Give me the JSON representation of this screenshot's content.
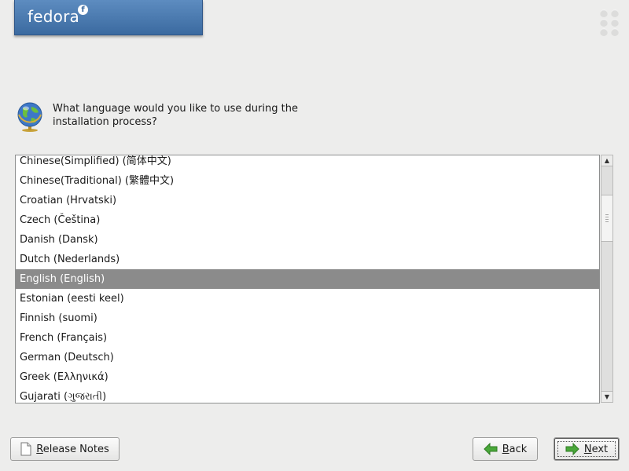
{
  "brand": {
    "name": "fedora",
    "mark": "f"
  },
  "prompt": {
    "icon": "globe-icon",
    "text": "What language would you like to use during the installation process?"
  },
  "language_list": {
    "selected_index": 6,
    "items": [
      {
        "label": "Chinese(Simplified) (简体中文)"
      },
      {
        "label": "Chinese(Traditional) (繁體中文)"
      },
      {
        "label": "Croatian (Hrvatski)"
      },
      {
        "label": "Czech (Čeština)"
      },
      {
        "label": "Danish (Dansk)"
      },
      {
        "label": "Dutch (Nederlands)"
      },
      {
        "label": "English (English)"
      },
      {
        "label": "Estonian (eesti keel)"
      },
      {
        "label": "Finnish (suomi)"
      },
      {
        "label": "French (Français)"
      },
      {
        "label": "German (Deutsch)"
      },
      {
        "label": "Greek (Ελληνικά)"
      },
      {
        "label": "Gujarati (ગુજરાતી)"
      }
    ]
  },
  "buttons": {
    "release_notes": {
      "mnemonic": "R",
      "rest": "elease Notes",
      "icon": "document-icon"
    },
    "back": {
      "mnemonic": "B",
      "rest": "ack",
      "icon": "back-arrow-icon"
    },
    "next": {
      "mnemonic": "N",
      "rest": "ext",
      "icon": "next-arrow-icon"
    }
  },
  "colors": {
    "background": "#ededec",
    "banner": "#3b6aa0",
    "selection": "#8b8b8b",
    "arrow_green": "#3c9a2e"
  }
}
